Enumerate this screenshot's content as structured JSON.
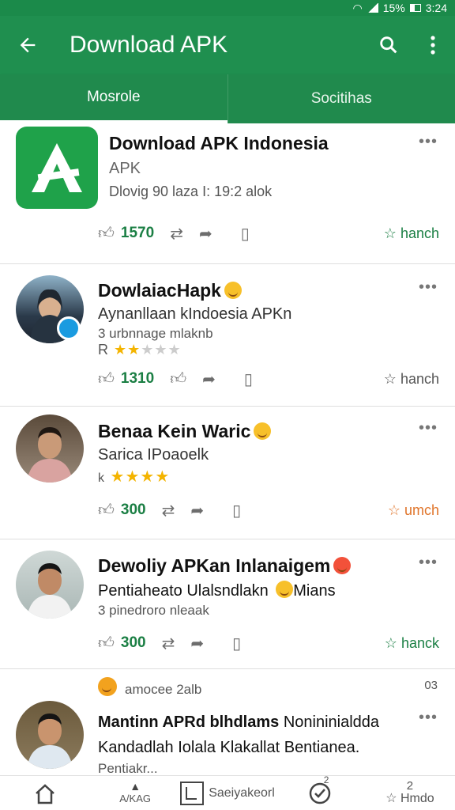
{
  "status_bar": {
    "battery": "15%",
    "time": "3:24"
  },
  "app_bar": {
    "title": "Download APK"
  },
  "tabs": [
    {
      "label": "Mosrole",
      "active": true
    },
    {
      "label": "Socitihas",
      "active": false
    }
  ],
  "cards": [
    {
      "type": "app",
      "name": "Download APK Indonesia",
      "sub": "APK",
      "meta": "Dlovig 90 laza I: 19:2 alok",
      "count": "1570",
      "tail": "hanch"
    },
    {
      "type": "user",
      "name": "DowlaiacHapk",
      "sub": "Aynanllaan kIndoesia APKn",
      "meta": "3 urbnnage mlaknb",
      "rating_prefix": "R",
      "rating": 2,
      "count": "1310",
      "tail": "hanch"
    },
    {
      "type": "user",
      "name": "Benaa Kein Waric",
      "sub": "Sarica IPoaoelk",
      "rating_prefix": "k",
      "rating": 4,
      "count": "300",
      "tail": "umch"
    },
    {
      "type": "user",
      "name": "Dewoliy APKan Inlanaigem",
      "sub": "Pentiaheato Ulalsndlakn",
      "sub_suffix": "Mians",
      "meta": "3 pinedroro nleaak",
      "count": "300",
      "tail": "hanck"
    },
    {
      "type": "user",
      "header": "amocee 2alb",
      "header_right": "03",
      "name": "Mantinn APRd blhdlams",
      "name_suffix": "Nonininialdda",
      "sub": "Kandadlah Iolala Klakallat Bentianea.",
      "meta": "Pentiakr..."
    }
  ],
  "bottom_nav": [
    {
      "label": "",
      "icon": "home-icon"
    },
    {
      "label": "A/KAG",
      "icon": "apk-icon"
    },
    {
      "label": "Saeiyakeorl",
      "icon": "save-icon"
    },
    {
      "label": "",
      "icon": "check-icon",
      "badge": "2"
    },
    {
      "label": "Hmdo",
      "icon": "star-icon",
      "badge": "2"
    }
  ],
  "colors": {
    "primary": "#1f8f4f",
    "accent_green": "#1b7f44",
    "star": "#f4b400",
    "orange": "#e0752b"
  }
}
